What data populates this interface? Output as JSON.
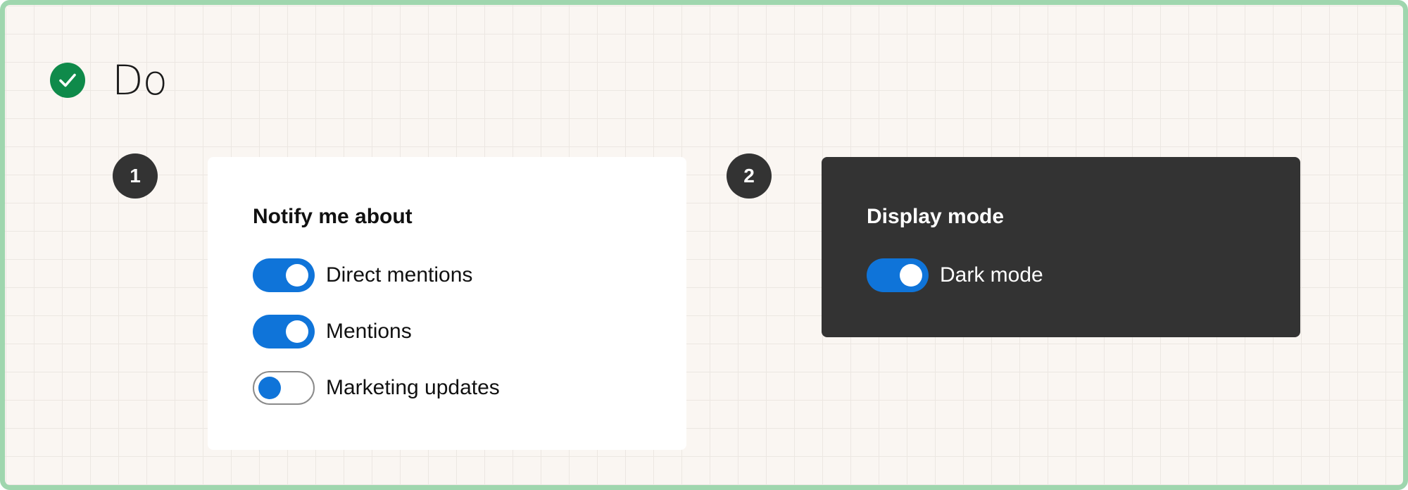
{
  "heading": {
    "text": "Do",
    "icon": "check-circle-icon",
    "icon_color": "#0f8a4a"
  },
  "accent_color": "#0f74d9",
  "examples": [
    {
      "number": "1",
      "theme": "light",
      "title": "Notify me about",
      "toggles": [
        {
          "label": "Direct mentions",
          "on": true
        },
        {
          "label": "Mentions",
          "on": true
        },
        {
          "label": "Marketing updates",
          "on": false
        }
      ]
    },
    {
      "number": "2",
      "theme": "dark",
      "title": "Display mode",
      "toggles": [
        {
          "label": "Dark mode",
          "on": true
        }
      ]
    }
  ]
}
